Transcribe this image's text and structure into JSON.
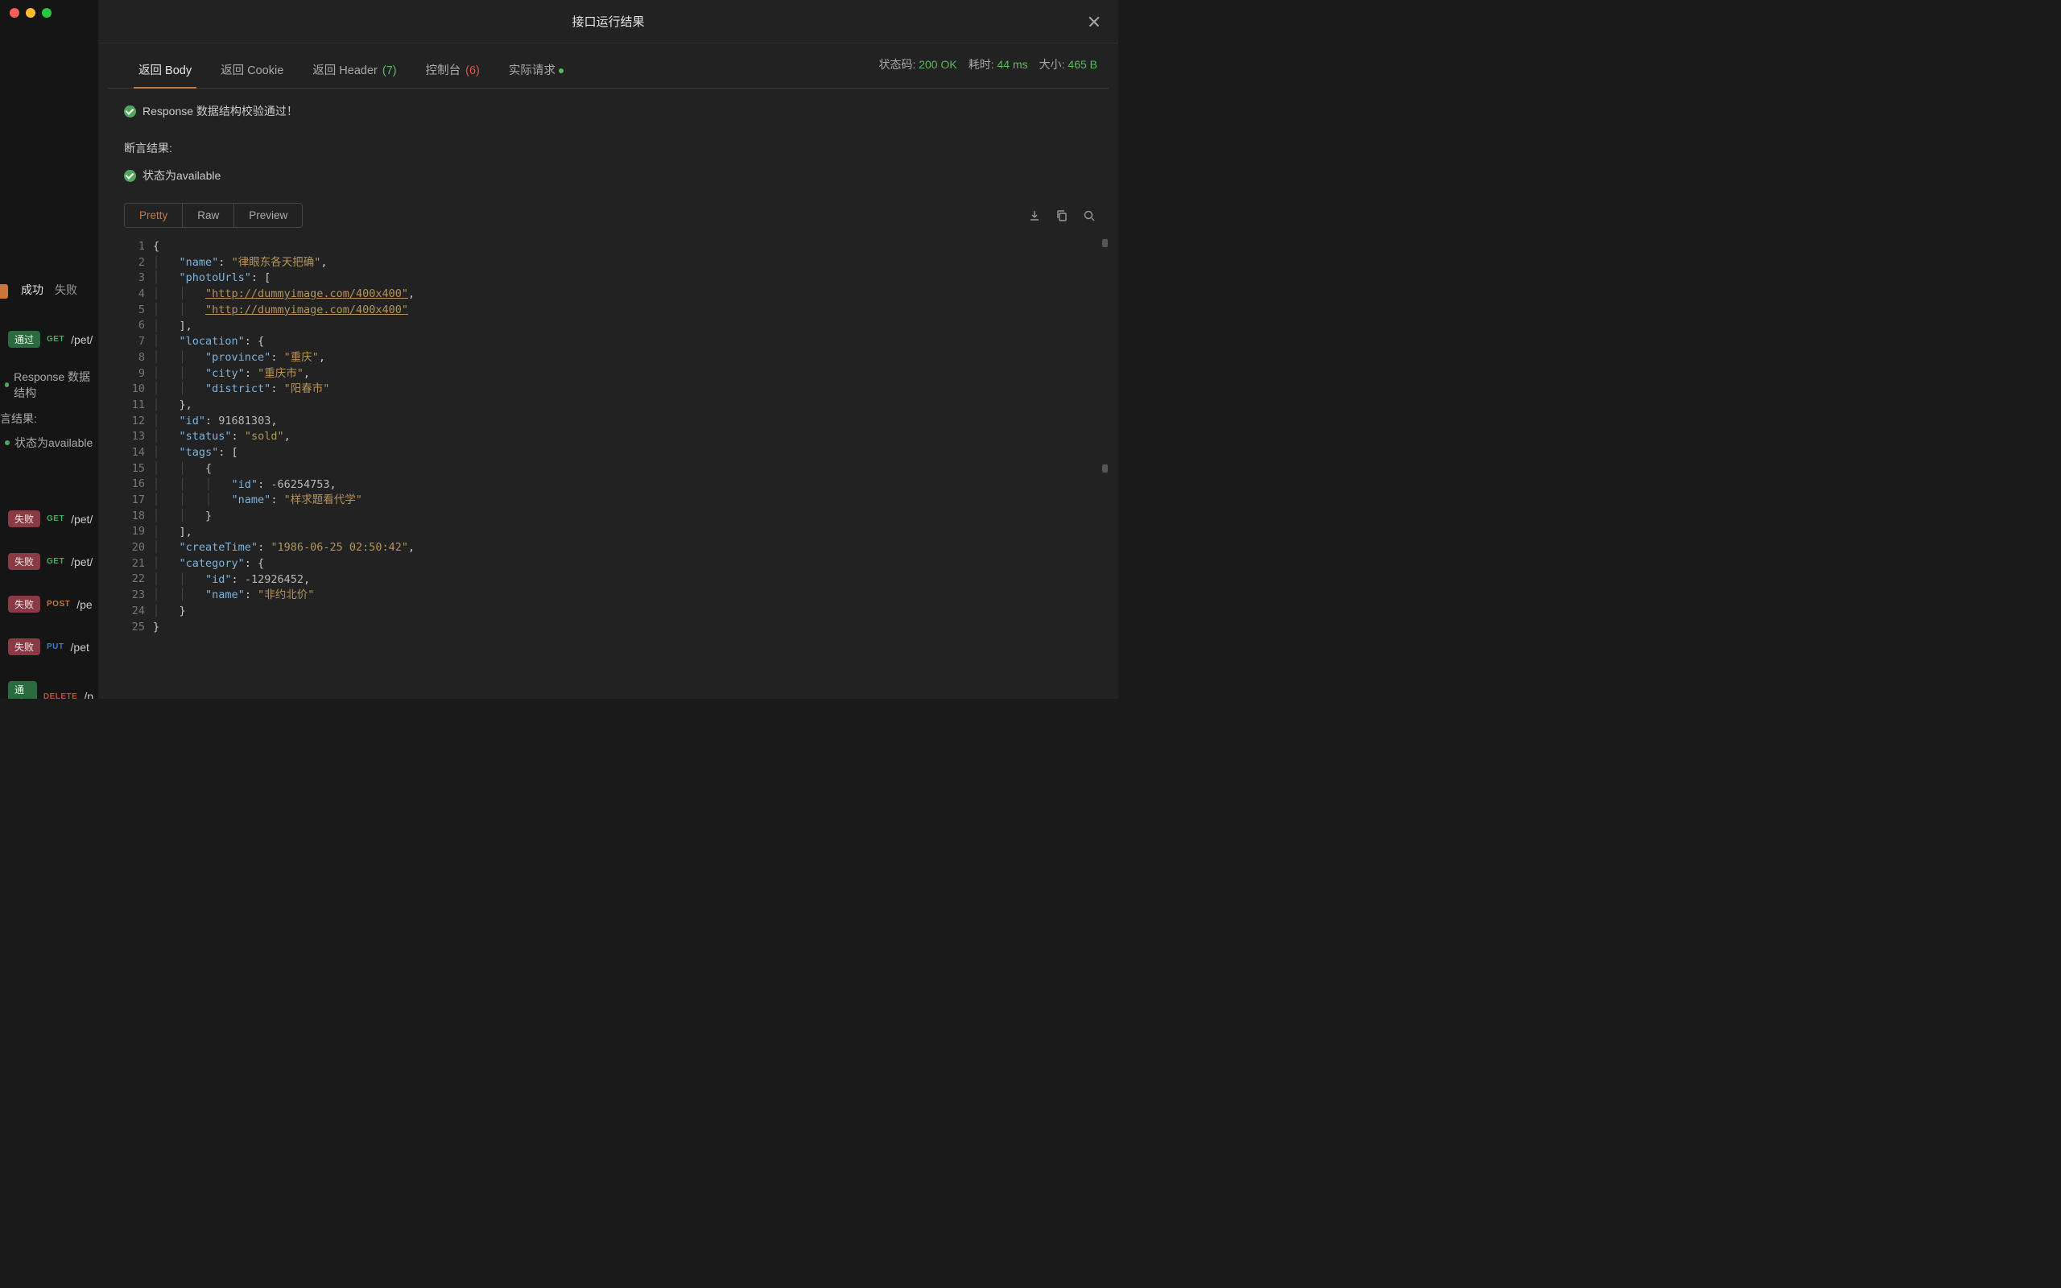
{
  "window": {
    "title": "接口运行结果"
  },
  "sidebar": {
    "filters": {
      "success": "成功",
      "fail": "失败"
    },
    "resp_text": "Response 数据结构",
    "assert_title": "言结果:",
    "assert_text": "状态为available",
    "items": [
      {
        "status": "pass",
        "status_label": "通过",
        "method": "GET",
        "method_class": "m-get",
        "path": "/pet/"
      },
      {
        "status": "fail",
        "status_label": "失败",
        "method": "GET",
        "method_class": "m-get",
        "path": "/pet/"
      },
      {
        "status": "fail",
        "status_label": "失败",
        "method": "GET",
        "method_class": "m-get",
        "path": "/pet/"
      },
      {
        "status": "fail",
        "status_label": "失败",
        "method": "POST",
        "method_class": "m-post",
        "path": "/pe"
      },
      {
        "status": "fail",
        "status_label": "失败",
        "method": "PUT",
        "method_class": "m-put",
        "path": "/pet"
      },
      {
        "status": "pass",
        "status_label": "通过",
        "method": "DELETE",
        "method_class": "m-delete",
        "path": "/p"
      }
    ]
  },
  "status": {
    "code_label": "状态码:",
    "code_value": "200 OK",
    "time_label": "耗时:",
    "time_value": "44 ms",
    "size_label": "大小:",
    "size_value": "465 B"
  },
  "tabs": {
    "body": "返回 Body",
    "cookie": "返回 Cookie",
    "header": "返回 Header",
    "header_count": "(7)",
    "console": "控制台",
    "console_count": "(6)",
    "request": "实际请求"
  },
  "validation": {
    "resp_ok": "Response 数据结构校验通过！",
    "assert_title": "断言结果:",
    "assert_1": "状态为available"
  },
  "view_tabs": {
    "pretty": "Pretty",
    "raw": "Raw",
    "preview": "Preview"
  },
  "code_lines": [
    [
      [
        "punct",
        "{"
      ]
    ],
    [
      [
        "indent",
        1
      ],
      [
        "key",
        "\"name\""
      ],
      [
        "punct",
        ": "
      ],
      [
        "str",
        "\"律眼东各天把确\""
      ],
      [
        "punct",
        ","
      ]
    ],
    [
      [
        "indent",
        1
      ],
      [
        "key",
        "\"photoUrls\""
      ],
      [
        "punct",
        ": ["
      ]
    ],
    [
      [
        "indent",
        2
      ],
      [
        "link",
        "\"http://dummyimage.com/400x400\""
      ],
      [
        "punct",
        ","
      ]
    ],
    [
      [
        "indent",
        2
      ],
      [
        "link",
        "\"http://dummyimage.com/400x400\""
      ]
    ],
    [
      [
        "indent",
        1
      ],
      [
        "punct",
        "],"
      ]
    ],
    [
      [
        "indent",
        1
      ],
      [
        "key",
        "\"location\""
      ],
      [
        "punct",
        ": {"
      ]
    ],
    [
      [
        "indent",
        2
      ],
      [
        "key",
        "\"province\""
      ],
      [
        "punct",
        ": "
      ],
      [
        "str",
        "\"重庆\""
      ],
      [
        "punct",
        ","
      ]
    ],
    [
      [
        "indent",
        2
      ],
      [
        "key",
        "\"city\""
      ],
      [
        "punct",
        ": "
      ],
      [
        "str",
        "\"重庆市\""
      ],
      [
        "punct",
        ","
      ]
    ],
    [
      [
        "indent",
        2
      ],
      [
        "key",
        "\"district\""
      ],
      [
        "punct",
        ": "
      ],
      [
        "str",
        "\"阳春市\""
      ]
    ],
    [
      [
        "indent",
        1
      ],
      [
        "punct",
        "},"
      ]
    ],
    [
      [
        "indent",
        1
      ],
      [
        "key",
        "\"id\""
      ],
      [
        "punct",
        ": "
      ],
      [
        "num",
        "91681303"
      ],
      [
        "punct",
        ","
      ]
    ],
    [
      [
        "indent",
        1
      ],
      [
        "key",
        "\"status\""
      ],
      [
        "punct",
        ": "
      ],
      [
        "str",
        "\"sold\""
      ],
      [
        "punct",
        ","
      ]
    ],
    [
      [
        "indent",
        1
      ],
      [
        "key",
        "\"tags\""
      ],
      [
        "punct",
        ": ["
      ]
    ],
    [
      [
        "indent",
        2
      ],
      [
        "punct",
        "{"
      ]
    ],
    [
      [
        "indent",
        3
      ],
      [
        "key",
        "\"id\""
      ],
      [
        "punct",
        ": "
      ],
      [
        "num",
        "-66254753"
      ],
      [
        "punct",
        ","
      ]
    ],
    [
      [
        "indent",
        3
      ],
      [
        "key",
        "\"name\""
      ],
      [
        "punct",
        ": "
      ],
      [
        "str",
        "\"样求题看代学\""
      ]
    ],
    [
      [
        "indent",
        2
      ],
      [
        "punct",
        "}"
      ]
    ],
    [
      [
        "indent",
        1
      ],
      [
        "punct",
        "],"
      ]
    ],
    [
      [
        "indent",
        1
      ],
      [
        "key",
        "\"createTime\""
      ],
      [
        "punct",
        ": "
      ],
      [
        "str",
        "\"1986-06-25 02:50:42\""
      ],
      [
        "punct",
        ","
      ]
    ],
    [
      [
        "indent",
        1
      ],
      [
        "key",
        "\"category\""
      ],
      [
        "punct",
        ": {"
      ]
    ],
    [
      [
        "indent",
        2
      ],
      [
        "key",
        "\"id\""
      ],
      [
        "punct",
        ": "
      ],
      [
        "num",
        "-12926452"
      ],
      [
        "punct",
        ","
      ]
    ],
    [
      [
        "indent",
        2
      ],
      [
        "key",
        "\"name\""
      ],
      [
        "punct",
        ": "
      ],
      [
        "str",
        "\"非约北价\""
      ]
    ],
    [
      [
        "indent",
        1
      ],
      [
        "punct",
        "}"
      ]
    ],
    [
      [
        "punct",
        "}"
      ]
    ]
  ]
}
